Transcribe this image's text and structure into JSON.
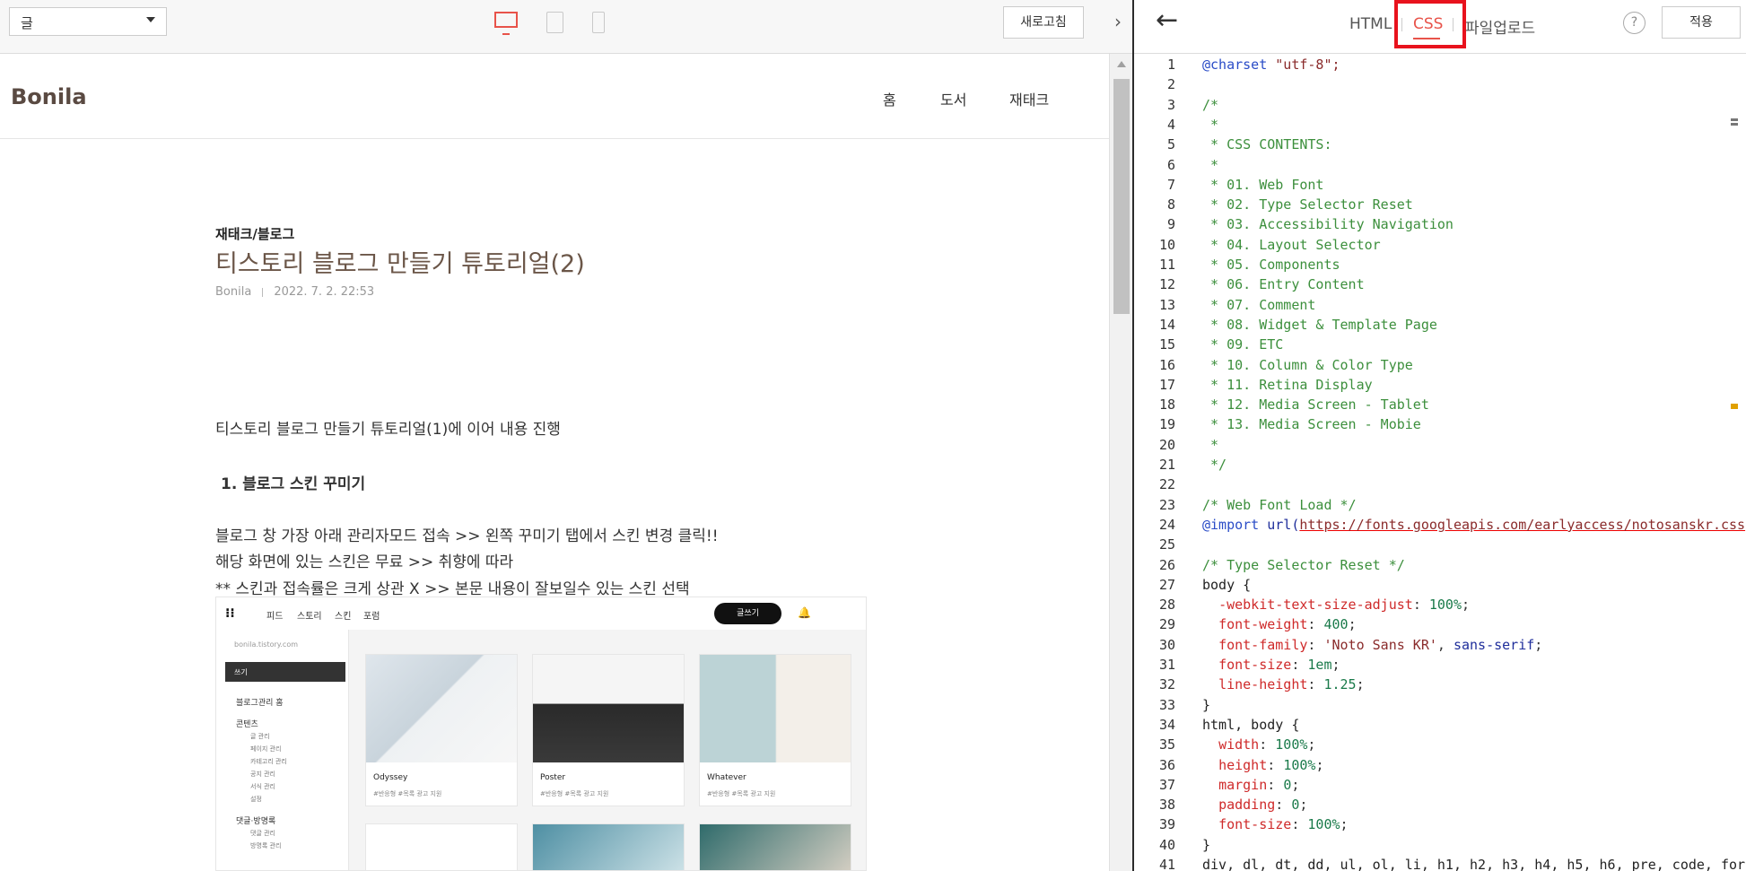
{
  "preview_toolbar": {
    "select_value": "글",
    "refresh_label": "새로고침"
  },
  "blog": {
    "name": "Bonila",
    "nav": [
      "홈",
      "도서",
      "재태크"
    ],
    "category": "재태크/블로그",
    "title": "티스토리 블로그 만들기 튜토리얼(2)",
    "author": "Bonila",
    "date": "2022. 7. 2. 22:53",
    "paragraphs": {
      "intro": "티스토리 블로그 만들기 튜토리얼(1)에 이어 내용 진행",
      "heading": "1. 블로그 스킨 꾸미기",
      "line1": "블로그 창 가장 아래 관리자모드 접속 >> 왼쪽 꾸미기 탭에서 스킨 변경 클릭!!",
      "line2": "해당 화면에 있는 스킨은 무료 >> 취향에 따라",
      "line3": "** 스킨과 접속률은 크게 상관 X >> 본문 내용이 잘보일수 있는 스킨 선택"
    },
    "screenshot": {
      "menu": [
        "피드",
        "스토리",
        "스킨",
        "포럼"
      ],
      "write_button": "글쓰기",
      "blog_url": "bonila.tistory.com",
      "dropdown": "쓰기",
      "side_items": [
        "블로그관리 홈",
        "콘텐츠",
        "댓글·방명록"
      ],
      "side_sub_contents": [
        "글 관리",
        "페이지 관리",
        "카테고리 관리",
        "공지 관리",
        "서식 관리",
        "설정"
      ],
      "side_sub_comments": [
        "댓글 관리",
        "방명록 관리"
      ],
      "skins": [
        {
          "name": "Odyssey",
          "tags": "#반응형  #목록 광고 지원"
        },
        {
          "name": "Poster",
          "tags": "#반응형  #목록 광고 지원"
        },
        {
          "name": "Whatever",
          "tags": "#반응형  #목록 광고 지원"
        }
      ]
    }
  },
  "editor_toolbar": {
    "tabs": [
      "HTML",
      "CSS",
      "파일업로드"
    ],
    "active_tab": "CSS",
    "help": "?",
    "apply_label": "적용"
  },
  "code_lines": [
    {
      "n": "1",
      "t": "@charset \"utf-8\";"
    },
    {
      "n": "2",
      "t": ""
    },
    {
      "n": "3",
      "t": "/*"
    },
    {
      "n": "4",
      "t": " *"
    },
    {
      "n": "5",
      "t": " * CSS CONTENTS:"
    },
    {
      "n": "6",
      "t": " *"
    },
    {
      "n": "7",
      "t": " * 01. Web Font"
    },
    {
      "n": "8",
      "t": " * 02. Type Selector Reset"
    },
    {
      "n": "9",
      "t": " * 03. Accessibility Navigation"
    },
    {
      "n": "10",
      "t": " * 04. Layout Selector"
    },
    {
      "n": "11",
      "t": " * 05. Components"
    },
    {
      "n": "12",
      "t": " * 06. Entry Content"
    },
    {
      "n": "13",
      "t": " * 07. Comment"
    },
    {
      "n": "14",
      "t": " * 08. Widget & Template Page"
    },
    {
      "n": "15",
      "t": " * 09. ETC"
    },
    {
      "n": "16",
      "t": " * 10. Column & Color Type"
    },
    {
      "n": "17",
      "t": " * 11. Retina Display"
    },
    {
      "n": "18",
      "t": " * 12. Media Screen - Tablet"
    },
    {
      "n": "19",
      "t": " * 13. Media Screen - Mobie"
    },
    {
      "n": "20",
      "t": " *"
    },
    {
      "n": "21",
      "t": " */"
    },
    {
      "n": "22",
      "t": ""
    },
    {
      "n": "23",
      "t": "/* Web Font Load */"
    },
    {
      "n": "24",
      "t": "@import url(https://fonts.googleapis.com/earlyaccess/notosanskr.css"
    },
    {
      "n": "25",
      "t": ""
    },
    {
      "n": "26",
      "t": "/* Type Selector Reset */"
    },
    {
      "n": "27",
      "t": "body {"
    },
    {
      "n": "28",
      "t": "  -webkit-text-size-adjust: 100%;"
    },
    {
      "n": "29",
      "t": "  font-weight: 400;"
    },
    {
      "n": "30",
      "t": "  font-family: 'Noto Sans KR', sans-serif;"
    },
    {
      "n": "31",
      "t": "  font-size: 1em;"
    },
    {
      "n": "32",
      "t": "  line-height: 1.25;"
    },
    {
      "n": "33",
      "t": "}"
    },
    {
      "n": "34",
      "t": "html, body {"
    },
    {
      "n": "35",
      "t": "  width: 100%;"
    },
    {
      "n": "36",
      "t": "  height: 100%;"
    },
    {
      "n": "37",
      "t": "  margin: 0;"
    },
    {
      "n": "38",
      "t": "  padding: 0;"
    },
    {
      "n": "39",
      "t": "  font-size: 100%;"
    },
    {
      "n": "40",
      "t": "}"
    },
    {
      "n": "41",
      "t": "div, dl, dt, dd, ul, ol, li, h1, h2, h3, h4, h5, h6, pre, code, for"
    }
  ]
}
